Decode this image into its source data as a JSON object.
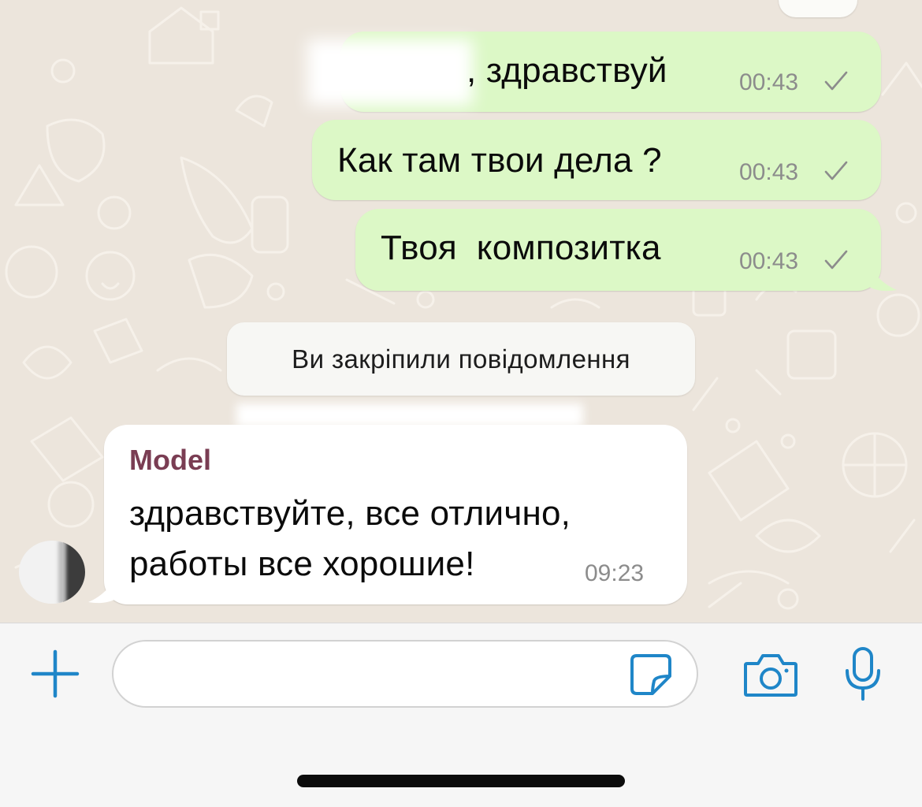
{
  "colors": {
    "chat_background": "#ece5dc",
    "outgoing_bubble": "#dcf8c6",
    "incoming_bubble": "#ffffff",
    "accent_blue": "#1f86c8",
    "sender_name": "#7a3d53"
  },
  "messages": {
    "outgoing": [
      {
        "text": ", здравствуй",
        "time": "00:43"
      },
      {
        "text": "Как там твои дела ?",
        "time": "00:43"
      },
      {
        "text": "Твоя  композитка",
        "time": "00:43"
      }
    ],
    "system_notice": "Ви закріпили повідомлення",
    "incoming": {
      "sender": "Model",
      "lines": [
        "здравствуйте, все отлично,",
        "работы все хорошие!"
      ],
      "time": "09:23"
    }
  },
  "input_bar": {
    "placeholder": "",
    "icons": [
      "plus-icon",
      "sticker-icon",
      "camera-icon",
      "microphone-icon"
    ]
  }
}
